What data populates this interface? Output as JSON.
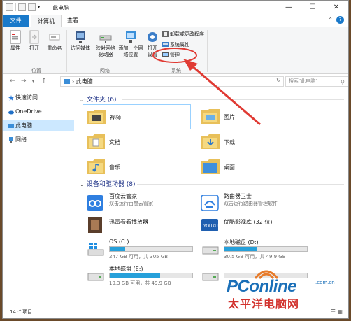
{
  "window": {
    "title": "此电脑",
    "minimize_glyph": "—",
    "maximize_glyph": "☐",
    "close_glyph": "✕"
  },
  "ribbon_tabs": [
    {
      "label": "文件"
    },
    {
      "label": "计算机"
    },
    {
      "label": "查看"
    }
  ],
  "ribbon": {
    "location_group": {
      "label": "位置",
      "buttons": [
        {
          "label": "属性"
        },
        {
          "label": "打开"
        },
        {
          "label": "重命名"
        }
      ]
    },
    "network_group": {
      "label": "网络",
      "buttons": [
        {
          "label": "访问媒体"
        },
        {
          "label": "映射网络驱动器"
        },
        {
          "label": "添加一个网络位置"
        }
      ]
    },
    "system_group": {
      "label": "系统",
      "open_label": "打开设置",
      "small_buttons": [
        {
          "label": "卸载或更改程序"
        },
        {
          "label": "系统属性"
        },
        {
          "label": "管理"
        }
      ]
    }
  },
  "address": {
    "path": "此电脑",
    "search_placeholder": "搜索\"此电脑\""
  },
  "nav_pane": [
    {
      "label": "快速访问"
    },
    {
      "label": "OneDrive"
    },
    {
      "label": "此电脑"
    },
    {
      "label": "网络"
    }
  ],
  "folders_group": {
    "title": "文件夹 (6)",
    "items": [
      {
        "label": "视频"
      },
      {
        "label": "图片"
      },
      {
        "label": "文档"
      },
      {
        "label": "下载"
      },
      {
        "label": "音乐"
      },
      {
        "label": "桌面"
      }
    ]
  },
  "devices_group": {
    "title": "设备和驱动器 (8)",
    "apps": [
      {
        "name": "百度云管家",
        "sub": "双击运行百度云管家"
      },
      {
        "name": "路由器卫士",
        "sub": "双击运行路由器管理软件"
      },
      {
        "name": "迅雷看看播放器",
        "sub": ""
      },
      {
        "name": "优酷影视库 (32 位)",
        "sub": ""
      }
    ],
    "drives": [
      {
        "name": "OS (C:)",
        "free": "247 GB 可用，共 305 GB",
        "used_fraction": 0.19
      },
      {
        "name": "本地磁盘 (D:)",
        "free": "30.5 GB 可用，共 49.9 GB",
        "used_fraction": 0.39
      },
      {
        "name": "本地磁盘 (E:)",
        "free": "19.3 GB 可用，共 49.9 GB",
        "used_fraction": 0.61
      },
      {
        "name": "",
        "free": "",
        "used_fraction": 0.0
      }
    ]
  },
  "status": {
    "count": "14 个项目"
  },
  "watermark": {
    "brand": "PConline",
    "domain": ".com.cn",
    "chinese": "太平洋电脑网"
  },
  "colors": {
    "accent": "#1979ca",
    "drive_fill": "#26a0da",
    "selected": "#cce8ff",
    "annotation": "#e03a33"
  }
}
